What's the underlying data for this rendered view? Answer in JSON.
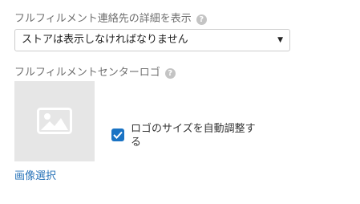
{
  "contact_details": {
    "label": "フルフィルメント連絡先の詳細を表示",
    "help_icon": "?",
    "selected_value": "ストアは表示しなければなりません",
    "caret": "▼"
  },
  "logo": {
    "label": "フルフィルメントセンターロゴ",
    "help_icon": "?",
    "placeholder_icon": "image-placeholder-icon",
    "auto_resize_label": "ロゴのサイズを自動調整する",
    "auto_resize_checked": true,
    "select_image_link": "画像選択"
  },
  "colors": {
    "accent": "#1a73c4",
    "link": "#2a74b9"
  }
}
